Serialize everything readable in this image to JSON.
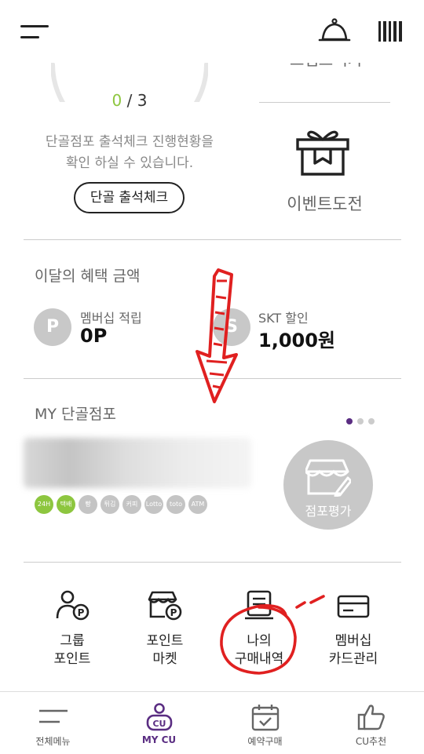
{
  "header": {
    "menu_icon": "hamburger-icon",
    "bell_icon": "bell-icon",
    "barcode_icon": "barcode-icon"
  },
  "checkin": {
    "progress_current": "0",
    "progress_sep": " / ",
    "progress_total": "3",
    "desc_line1": "단골점포 출석체크 진행현황을",
    "desc_line2": "확인 하실 수 있습니다.",
    "button_label": "단골 출석체크"
  },
  "stamp": {
    "label": "스탬프찍기"
  },
  "event": {
    "label": "이벤트도전",
    "icon": "gift-icon"
  },
  "benefits": {
    "title": "이달의 혜택 금액",
    "items": [
      {
        "icon_text": "P",
        "label": "멤버십 적립",
        "value": "0P"
      },
      {
        "icon_text": "S",
        "label": "SKT 할인",
        "value": "1,000원"
      }
    ]
  },
  "store": {
    "title": "MY 단골점포",
    "badges": [
      "24H",
      "택배",
      "빵",
      "튀김",
      "커피",
      "Lotto",
      "toto",
      "ATM"
    ],
    "review_label": "점포평가",
    "page_dots": 3,
    "active_dot": 0
  },
  "quick_menu": {
    "items": [
      {
        "label": "그룹\n포인트",
        "icon": "group-point-icon"
      },
      {
        "label": "포인트\n마켓",
        "icon": "point-market-icon"
      },
      {
        "label": "나의\n구매내역",
        "icon": "receipt-icon"
      },
      {
        "label": "멤버십\n카드관리",
        "icon": "card-icon"
      }
    ]
  },
  "bottom_nav": {
    "items": [
      {
        "label": "전체메뉴",
        "icon": "menu-icon"
      },
      {
        "label": "MY CU",
        "icon": "my-cu-icon",
        "active": true
      },
      {
        "label": "예약구매",
        "icon": "calendar-icon"
      },
      {
        "label": "CU추천",
        "icon": "thumbs-up-icon"
      }
    ]
  },
  "colors": {
    "accent_purple": "#5a2d82",
    "accent_green": "#8dc63f",
    "annotation_red": "#e02020",
    "badge_gray": "#c4c4c4"
  }
}
